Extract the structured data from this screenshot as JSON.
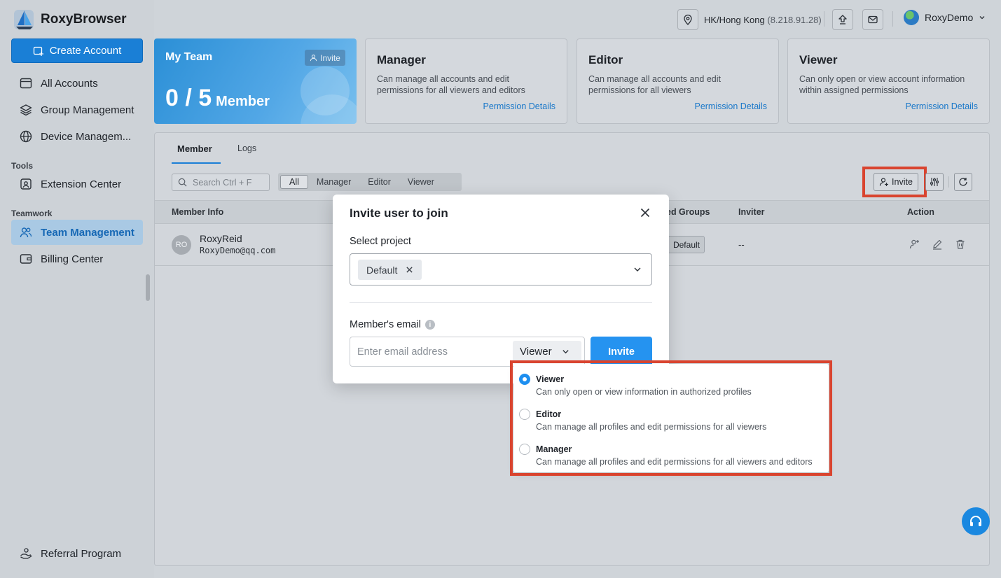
{
  "app": {
    "name": "RoxyBrowser"
  },
  "sidebar": {
    "create_label": "Create Account",
    "items": [
      {
        "label": "All Accounts"
      },
      {
        "label": "Group Management"
      },
      {
        "label": "Device Managem..."
      },
      {
        "label": "Extension Center"
      },
      {
        "label": "Team Management"
      },
      {
        "label": "Billing Center"
      }
    ],
    "sections": {
      "tools": "Tools",
      "teamwork": "Teamwork"
    },
    "referral": "Referral Program"
  },
  "topbar": {
    "location": "HK/Hong Kong",
    "ip": "(8.218.91.28)",
    "user": "RoxyDemo"
  },
  "team": {
    "title": "My Team",
    "invite_label": "Invite",
    "count": "0 / 5",
    "unit": "Member"
  },
  "roles": [
    {
      "title": "Manager",
      "desc": "Can manage all accounts and edit permissions for all viewers and editors",
      "link": "Permission Details"
    },
    {
      "title": "Editor",
      "desc": "Can manage all accounts and edit permissions for all viewers",
      "link": "Permission Details"
    },
    {
      "title": "Viewer",
      "desc": "Can only open or view account information within assigned permissions",
      "link": "Permission Details"
    }
  ],
  "tabs": {
    "member": "Member",
    "logs": "Logs"
  },
  "search": {
    "placeholder": "Search Ctrl + F"
  },
  "filters": [
    "All",
    "Manager",
    "Editor",
    "Viewer"
  ],
  "toolbar": {
    "invite_label": "Invite"
  },
  "table": {
    "columns": {
      "member_info": "Member Info",
      "groups": "ed Groups",
      "inviter": "Inviter",
      "action": "Action"
    },
    "rows": [
      {
        "initials": "RO",
        "name": "RoxyReid",
        "email": "RoxyDemo@qq.com",
        "group": "Default",
        "inviter": "--"
      }
    ]
  },
  "modal": {
    "title": "Invite user to join",
    "project_label": "Select project",
    "project_chip": "Default",
    "email_label": "Member's email",
    "email_placeholder": "Enter email address",
    "role_selected": "Viewer",
    "invite_label": "Invite"
  },
  "role_options": [
    {
      "title": "Viewer",
      "desc": "Can only open or view information in authorized profiles",
      "selected": true
    },
    {
      "title": "Editor",
      "desc": "Can manage all profiles and edit permissions for all viewers",
      "selected": false
    },
    {
      "title": "Manager",
      "desc": "Can manage all profiles and edit permissions for all viewers and editors",
      "selected": false
    }
  ],
  "colors": {
    "accent": "#1a7fd6",
    "highlight": "#d9442f"
  }
}
